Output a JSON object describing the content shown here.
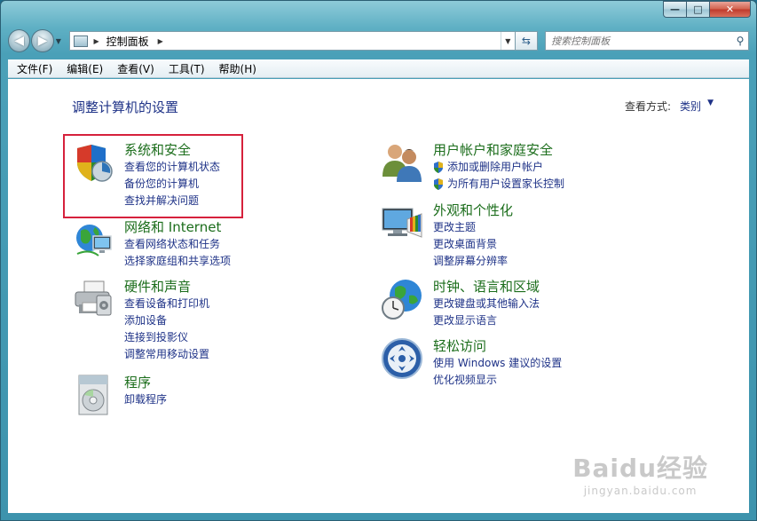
{
  "window": {
    "caption": {
      "minimize": "—",
      "maximize": "□",
      "close": "✕"
    }
  },
  "nav": {
    "back": "◀",
    "forward": "▶",
    "address_path": "控制面板",
    "search_placeholder": "搜索控制面板"
  },
  "menu": [
    "文件(F)",
    "编辑(E)",
    "查看(V)",
    "工具(T)",
    "帮助(H)"
  ],
  "main": {
    "heading": "调整计算机的设置",
    "view_by_label": "查看方式:",
    "view_by_value": "类别"
  },
  "categories_left": [
    {
      "title": "系统和安全",
      "icon": "security-shield-icon",
      "links": [
        "查看您的计算机状态",
        "备份您的计算机",
        "查找并解决问题"
      ]
    },
    {
      "title": "网络和 Internet",
      "icon": "network-globe-icon",
      "links": [
        "查看网络状态和任务",
        "选择家庭组和共享选项"
      ]
    },
    {
      "title": "硬件和声音",
      "icon": "printer-icon",
      "links": [
        "查看设备和打印机",
        "添加设备",
        "连接到投影仪",
        "调整常用移动设置"
      ]
    },
    {
      "title": "程序",
      "icon": "programs-icon",
      "links": [
        "卸载程序"
      ]
    }
  ],
  "categories_right": [
    {
      "title": "用户帐户和家庭安全",
      "icon": "users-icon",
      "links": [
        "添加或删除用户帐户",
        "为所有用户设置家长控制"
      ]
    },
    {
      "title": "外观和个性化",
      "icon": "appearance-icon",
      "links": [
        "更改主题",
        "更改桌面背景",
        "调整屏幕分辨率"
      ]
    },
    {
      "title": "时钟、语言和区域",
      "icon": "clock-globe-icon",
      "links": [
        "更改键盘或其他输入法",
        "更改显示语言"
      ]
    },
    {
      "title": "轻松访问",
      "icon": "ease-of-access-icon",
      "links": [
        "使用 Windows 建议的设置",
        "优化视频显示"
      ]
    }
  ],
  "watermark": {
    "logo": "Baidu经验",
    "url": "jingyan.baidu.com"
  }
}
